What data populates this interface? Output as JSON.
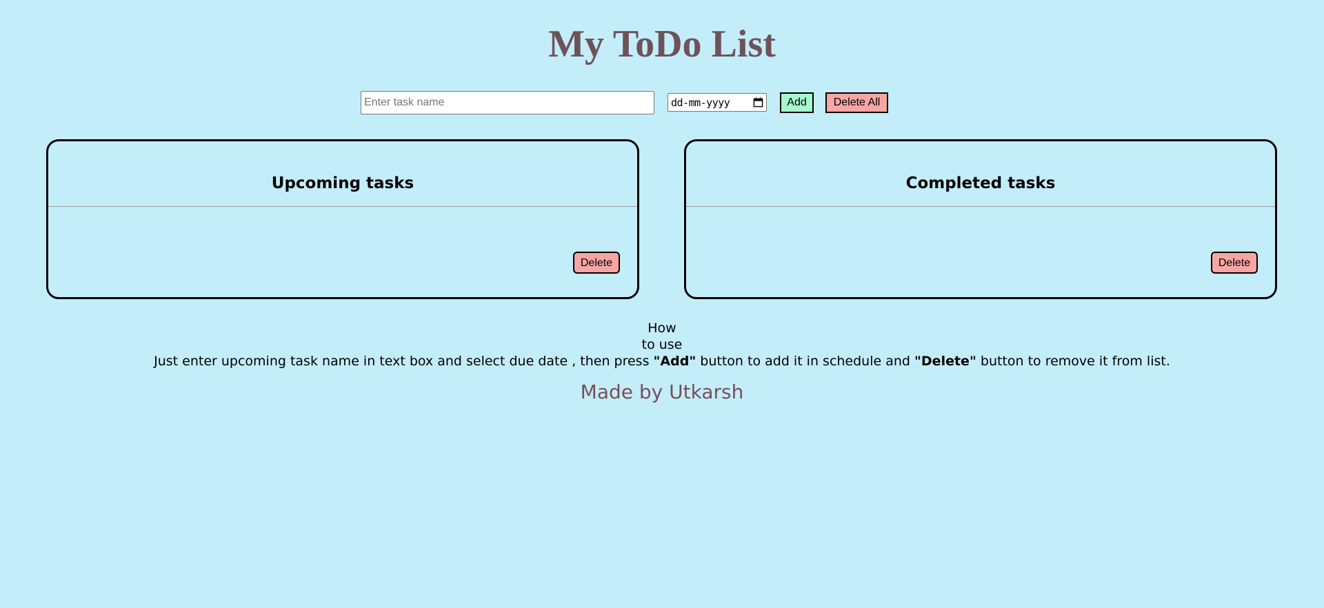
{
  "header": {
    "title": "My ToDo List"
  },
  "controls": {
    "task_placeholder": "Enter task name",
    "date_value": "dd-mm-yyyy",
    "add_label": "Add",
    "delete_all_label": "Delete All"
  },
  "panels": {
    "upcoming": {
      "heading": "Upcoming tasks",
      "delete_label": "Delete"
    },
    "completed": {
      "heading": "Completed tasks",
      "delete_label": "Delete"
    }
  },
  "howto": {
    "title_line1": "How",
    "title_line2": "to use",
    "text_part1": "Just enter upcoming task name in text box and select due date , then press ",
    "add_word": "\"Add\"",
    "text_part2": " button to add it in schedule and ",
    "delete_word": "\"Delete\"",
    "text_part3": " button to remove it from list."
  },
  "footer": {
    "credit": "Made by Utkarsh"
  },
  "colors": {
    "background": "#c4edfa",
    "title": "#6d5359",
    "add_button": "#a7f7cc",
    "delete_button": "#f7a6a4",
    "credit": "#7b4e58"
  },
  "icons": {
    "date_picker": "calendar-icon"
  }
}
